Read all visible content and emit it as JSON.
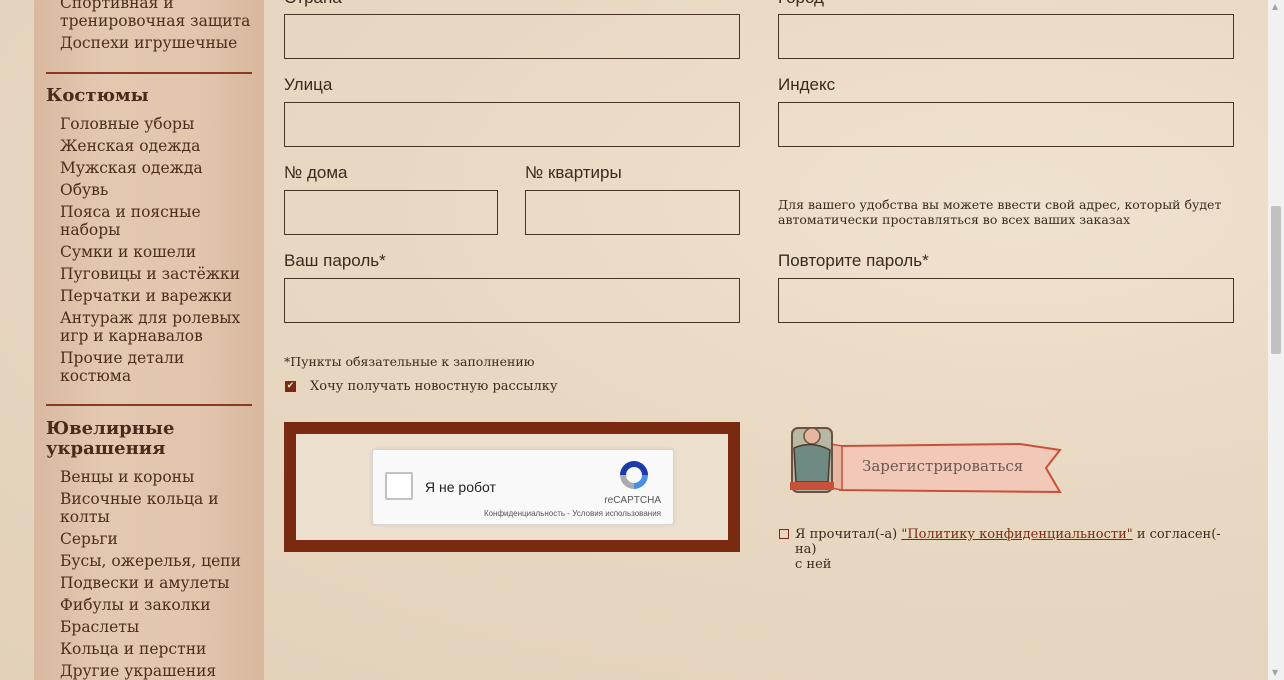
{
  "sidebar": {
    "top_items": [
      "Спортивная и",
      "тренировочная защита",
      "Доспехи игрушечные"
    ],
    "sections": [
      {
        "title": "Костюмы",
        "items": [
          "Головные уборы",
          "Женская одежда",
          "Мужская одежда",
          "Обувь",
          "Пояса и поясные",
          "наборы",
          "Сумки и кошели",
          "Пуговицы и застёжки",
          "Перчатки и варежки",
          "Антураж для ролевых",
          "игр и карнавалов",
          "Прочие детали",
          "костюма"
        ]
      },
      {
        "title_line1": "Ювелирные",
        "title_line2": "украшения",
        "items": [
          "Венцы и короны",
          "Височные кольца и",
          "колты",
          "Серьги",
          "Бусы, ожерелья, цепи",
          "Подвески и амулеты",
          "Фибулы и заколки",
          "Браслеты",
          "Кольца и перстни",
          "Другие украшения"
        ]
      }
    ]
  },
  "form": {
    "country_label": "Страна",
    "city_label": "Город",
    "street_label": "Улица",
    "index_label": "Индекс",
    "house_label": "№ дома",
    "apartment_label": "№ квартиры",
    "address_note_line1": "Для вашего удобства вы можете ввести свой адрес, который будет",
    "address_note_line2": "автоматически проставляться во всех ваших заказах",
    "password_label": "Ваш пароль*",
    "password_repeat_label": "Повторите пароль*",
    "required_note": "*Пункты обязательные к заполнению",
    "newsletter_label": "Хочу получать новостную рассылку",
    "newsletter_checked": true,
    "register_button": "Зарегистрироваться",
    "privacy_prefix": "Я прочитал(-а)",
    "privacy_link": "\"Политику конфиденциальности\"",
    "privacy_suffix": "и согласен(-на)",
    "privacy_line2": "с ней"
  },
  "recaptcha": {
    "label": "Я не робот",
    "brand": "reCAPTCHA",
    "links": "Конфиденциальность - Условия использования"
  },
  "colors": {
    "accent": "#7a2a10",
    "sidebar_rule": "#8a3a1e",
    "text": "#3a2a1e"
  }
}
